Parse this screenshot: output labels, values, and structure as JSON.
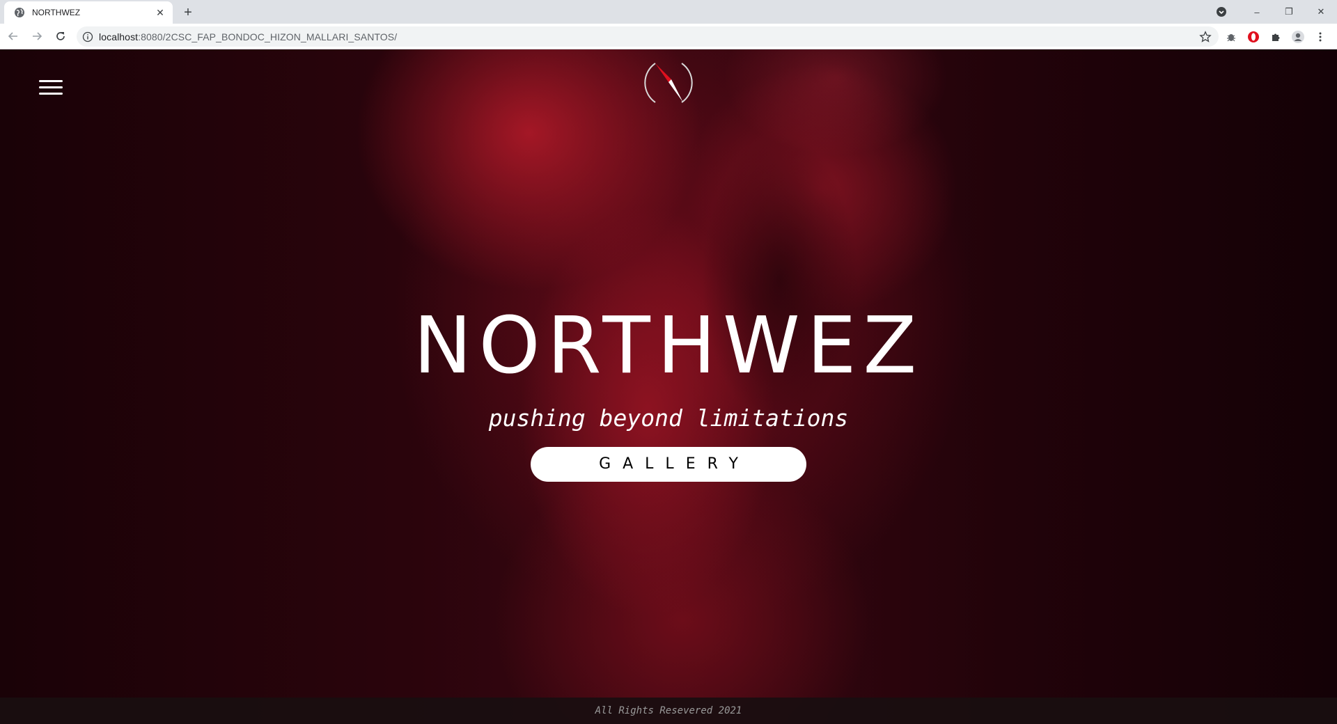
{
  "browser": {
    "tab_title": "NORTHWEZ",
    "tab_close_glyph": "✕",
    "new_tab_glyph": "+",
    "url_host": "localhost",
    "url_path": ":8080/2CSC_FAP_BONDOC_HIZON_MALLARI_SANTOS/",
    "window_controls": {
      "minimize": "–",
      "restore": "❐",
      "close": "✕"
    }
  },
  "page": {
    "logo_icon": "compass-icon",
    "brand_title": "NORTHWEZ",
    "tagline": "pushing beyond limitations",
    "gallery_button": "GALLERY",
    "footer_text": "All Rights Resevered 2021"
  },
  "colors": {
    "accent_red": "#e0101e",
    "hero_dark": "#2a040c",
    "button_bg": "#ffffff"
  }
}
